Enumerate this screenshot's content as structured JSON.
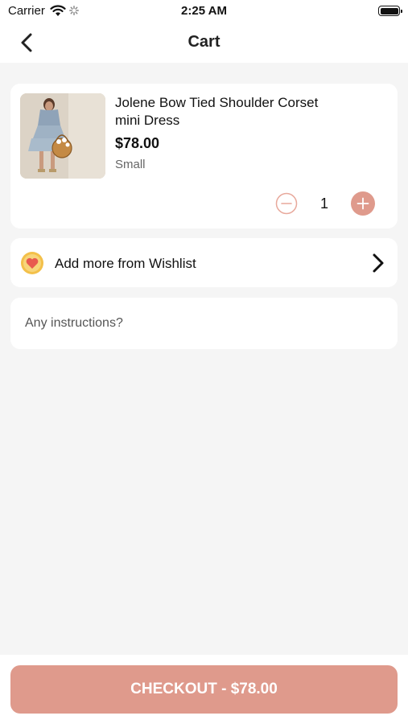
{
  "status_bar": {
    "carrier": "Carrier",
    "time": "2:25 AM",
    "icons": [
      "wifi-icon",
      "activity-spinner-icon",
      "battery-icon"
    ]
  },
  "nav": {
    "title": "Cart",
    "back_icon": "chevron-left-icon"
  },
  "cart_item": {
    "name": "Jolene Bow Tied Shoulder Corset mini Dress",
    "price": "$78.00",
    "size": "Small",
    "quantity": "1",
    "image": "product-photo-dress"
  },
  "wishlist": {
    "label": "Add more from Wishlist",
    "icon": "heart-icon",
    "chevron_icon": "chevron-right-icon"
  },
  "instructions": {
    "placeholder": "Any instructions?",
    "value": ""
  },
  "checkout": {
    "label": "CHECKOUT - $78.00"
  },
  "colors": {
    "accent": "#df9a8c",
    "background": "#f5f5f5",
    "card": "#ffffff",
    "heart": "#e85a4f",
    "heart_badge": "#f3c04a"
  }
}
